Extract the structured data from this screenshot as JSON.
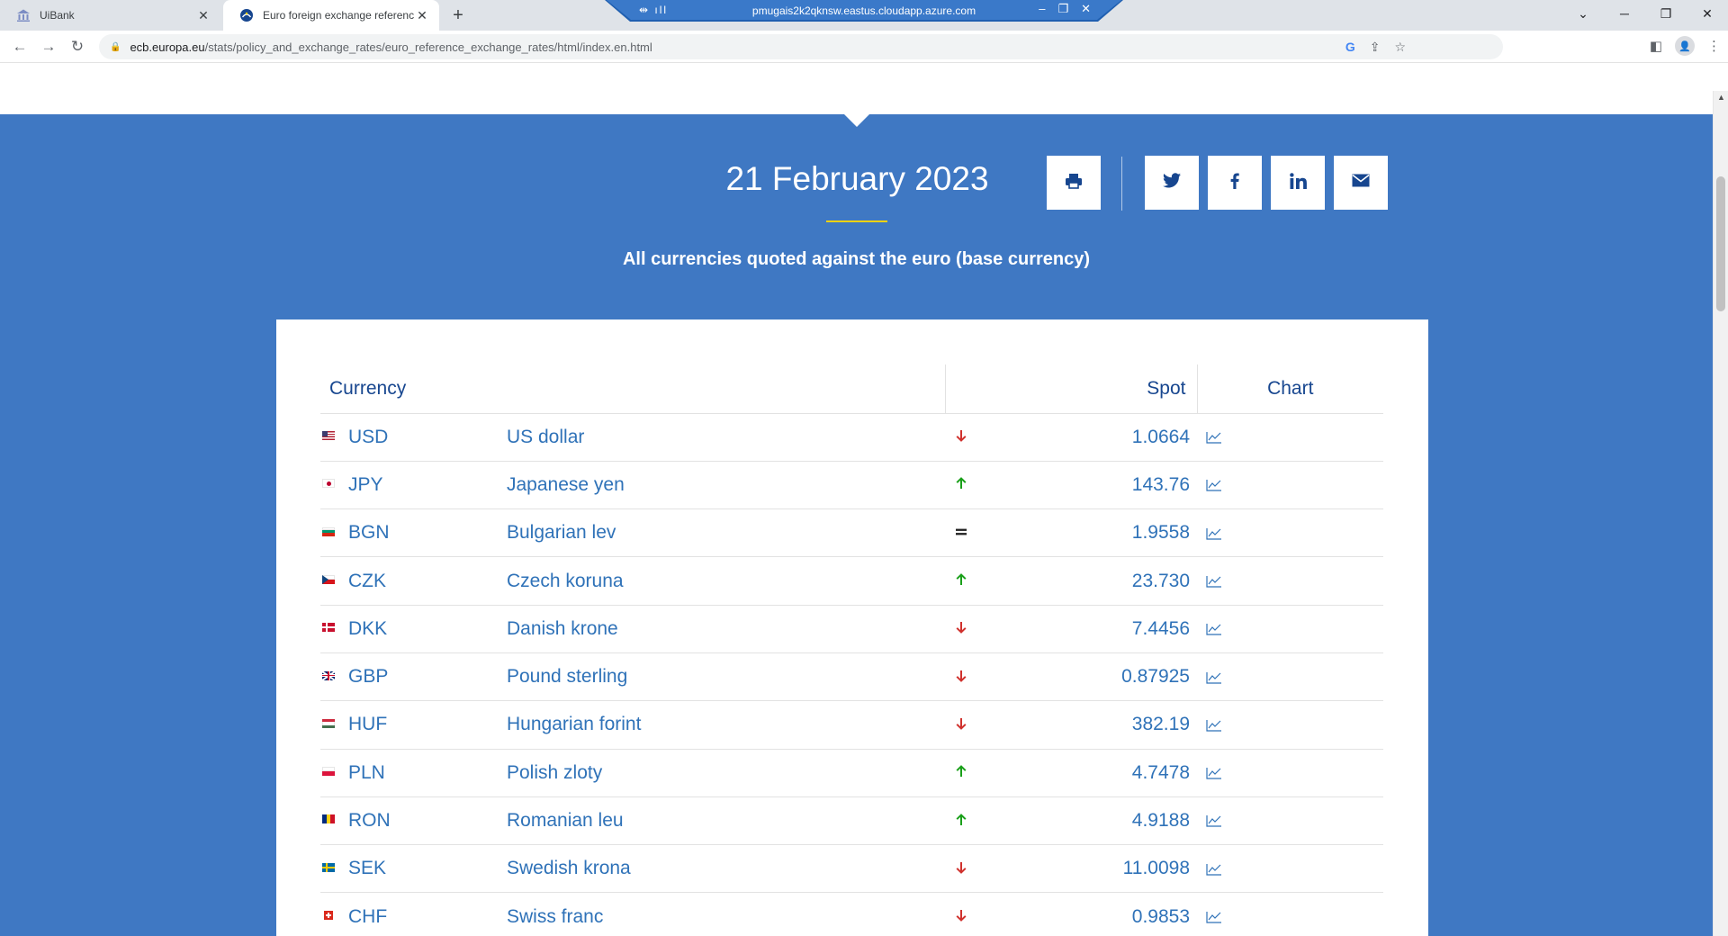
{
  "browser": {
    "tabs": [
      {
        "title": "UiBank",
        "active": false,
        "icon": "bank-icon"
      },
      {
        "title": "Euro foreign exchange reference",
        "active": true,
        "icon": "ecb-icon"
      }
    ],
    "new_tab": "+",
    "remote_session_title": "pmugais2k2qknsw.eastus.cloudapp.azure.com",
    "address": {
      "host": "ecb.europa.eu",
      "path": "/stats/policy_and_exchange_rates/euro_reference_exchange_rates/html/index.en.html"
    }
  },
  "page": {
    "date": "21 February 2023",
    "subtitle": "All currencies quoted against the euro (base currency)",
    "share_buttons": [
      "print-icon",
      "twitter-icon",
      "facebook-icon",
      "linkedin-icon",
      "email-icon"
    ],
    "colors": {
      "header_blue": "#3f78c3",
      "link_blue": "#2f72b8",
      "heading_navy": "#17468f",
      "accent_yellow": "#ffd200",
      "trend_up": "#1aa01a",
      "trend_down": "#d0312d"
    }
  },
  "table": {
    "headers": {
      "currency": "Currency",
      "spot": "Spot",
      "chart": "Chart"
    },
    "rows": [
      {
        "code": "USD",
        "name": "US dollar",
        "trend": "down",
        "spot": "1.0664",
        "flag": "us-flag"
      },
      {
        "code": "JPY",
        "name": "Japanese yen",
        "trend": "up",
        "spot": "143.76",
        "flag": "jp-flag"
      },
      {
        "code": "BGN",
        "name": "Bulgarian lev",
        "trend": "equal",
        "spot": "1.9558",
        "flag": "bg-flag"
      },
      {
        "code": "CZK",
        "name": "Czech koruna",
        "trend": "up",
        "spot": "23.730",
        "flag": "cz-flag"
      },
      {
        "code": "DKK",
        "name": "Danish krone",
        "trend": "down",
        "spot": "7.4456",
        "flag": "dk-flag"
      },
      {
        "code": "GBP",
        "name": "Pound sterling",
        "trend": "down",
        "spot": "0.87925",
        "flag": "gb-flag"
      },
      {
        "code": "HUF",
        "name": "Hungarian forint",
        "trend": "down",
        "spot": "382.19",
        "flag": "hu-flag"
      },
      {
        "code": "PLN",
        "name": "Polish zloty",
        "trend": "up",
        "spot": "4.7478",
        "flag": "pl-flag"
      },
      {
        "code": "RON",
        "name": "Romanian leu",
        "trend": "up",
        "spot": "4.9188",
        "flag": "ro-flag"
      },
      {
        "code": "SEK",
        "name": "Swedish krona",
        "trend": "down",
        "spot": "11.0098",
        "flag": "se-flag"
      },
      {
        "code": "CHF",
        "name": "Swiss franc",
        "trend": "down",
        "spot": "0.9853",
        "flag": "ch-flag"
      }
    ]
  }
}
